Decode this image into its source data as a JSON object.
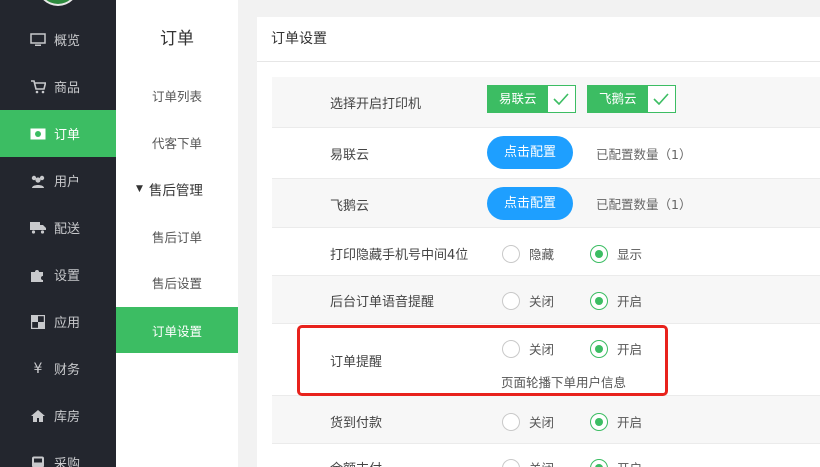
{
  "nav": {
    "items": [
      {
        "label": "概览",
        "icon": "monitor-icon"
      },
      {
        "label": "商品",
        "icon": "cart-icon"
      },
      {
        "label": "订单",
        "icon": "money-icon"
      },
      {
        "label": "用户",
        "icon": "users-icon"
      },
      {
        "label": "配送",
        "icon": "truck-icon"
      },
      {
        "label": "设置",
        "icon": "puzzle-icon"
      },
      {
        "label": "应用",
        "icon": "app-icon"
      },
      {
        "label": "财务",
        "icon": "yen-icon"
      },
      {
        "label": "库房",
        "icon": "home-icon"
      },
      {
        "label": "采购",
        "icon": "bus-icon"
      }
    ],
    "active": "订单"
  },
  "subnav": {
    "title": "订单",
    "items": [
      "订单列表",
      "代客下单",
      "售后管理",
      "售后订单",
      "售后设置",
      "订单设置"
    ],
    "active": "订单设置"
  },
  "panel": {
    "title": "订单设置",
    "printer": {
      "label": "选择开启打印机",
      "options": [
        "易联云",
        "飞鹅云"
      ]
    },
    "yilianyun": {
      "label": "易联云",
      "button": "点击配置",
      "count": "已配置数量（1）"
    },
    "feieyun": {
      "label": "飞鹅云",
      "button": "点击配置",
      "count": "已配置数量（1）"
    },
    "hide_phone": {
      "label": "打印隐藏手机号中间4位",
      "opt1": "隐藏",
      "opt2": "显示",
      "selected": "显示"
    },
    "voice": {
      "label": "后台订单语音提醒",
      "opt1": "关闭",
      "opt2": "开启",
      "selected": "开启"
    },
    "order_remind": {
      "label": "订单提醒",
      "opt1": "关闭",
      "opt2": "开启",
      "selected": "开启",
      "hint": "页面轮播下单用户信息"
    },
    "cod": {
      "label": "货到付款",
      "opt1": "关闭",
      "opt2": "开启",
      "selected": "开启"
    },
    "balance": {
      "label": "余额支付",
      "opt1": "关闭",
      "opt2": "开启",
      "selected": "开启"
    }
  },
  "colors": {
    "accent": "#3cbd63",
    "nav_bg": "#23262e",
    "blue": "#1e9fff",
    "highlight": "#e8221c"
  }
}
